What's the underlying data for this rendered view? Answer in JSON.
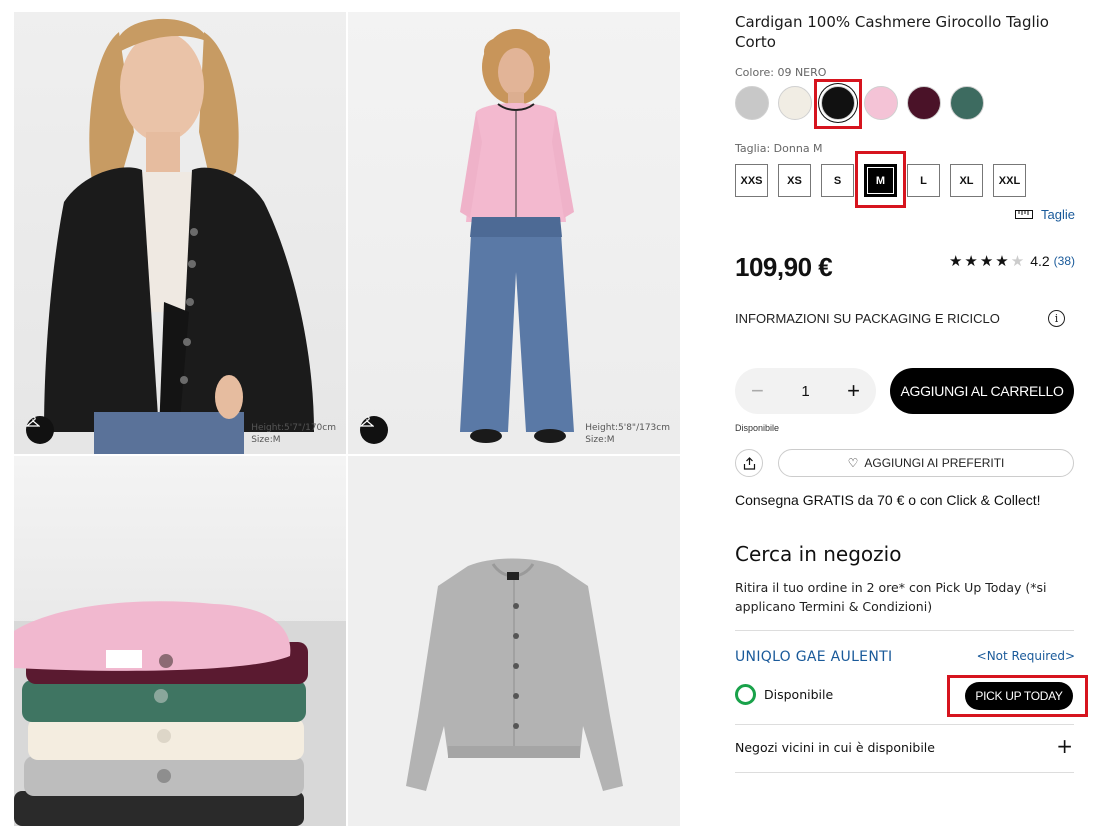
{
  "product": {
    "title": "Cardigan 100% Cashmere Girocollo Taglio Corto",
    "color_label": "Colore: 09 NERO",
    "colors": [
      {
        "name": "grigio",
        "hex": "#c8c8c8"
      },
      {
        "name": "bianco",
        "hex": "#f1ede4"
      },
      {
        "name": "nero",
        "hex": "#111111",
        "selected": true
      },
      {
        "name": "rosa",
        "hex": "#f4c3d6"
      },
      {
        "name": "vino",
        "hex": "#4a1228"
      },
      {
        "name": "verde",
        "hex": "#3d6b60"
      }
    ],
    "size_label": "Taglia: Donna M",
    "sizes": [
      "XXS",
      "XS",
      "S",
      "M",
      "L",
      "XL",
      "XXL"
    ],
    "selected_size": "M",
    "size_guide": "Taglie",
    "price": "109,90 €",
    "rating": {
      "value": "4.2",
      "count": "(38)",
      "stars": 4
    },
    "packaging": "INFORMAZIONI SU PACKAGING E RICICLO",
    "quantity": "1",
    "add_to_cart": "AGGIUNGI AL CARRELLO",
    "availability": "Disponibile",
    "favorites": "AGGIUNGI AI PREFERITI",
    "delivery": "Consegna GRATIS da 70 € o con Click & Collect!"
  },
  "store": {
    "title": "Cerca in negozio",
    "description": "Ritira il tuo ordine in 2 ore* con Pick Up Today (*si applicano Termini & Condizioni)",
    "name": "UNIQLO GAE AULENTI",
    "not_required": "<Not Required>",
    "stock": "Disponibile",
    "pickup_button": "PICK UP TODAY",
    "nearby": "Negozi vicini in cui è disponibile"
  },
  "gallery": {
    "model1_info": "Height:5'7\"/170cm\nSize:M",
    "model2_info": "Height:5'8\"/173cm\nSize:M"
  },
  "colors": {
    "link": "#1a5a9a",
    "highlight": "#d6141e",
    "stock_ok": "#19a24a"
  }
}
